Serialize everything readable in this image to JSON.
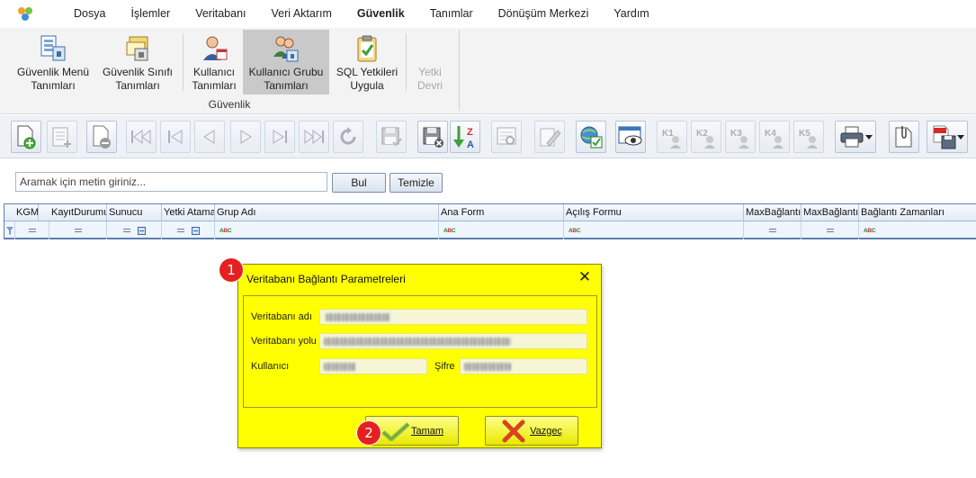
{
  "menu": {
    "items": [
      "Dosya",
      "İşlemler",
      "Veritabanı",
      "Veri Aktarım",
      "Güvenlik",
      "Tanımlar",
      "Dönüşüm Merkezi",
      "Yardım"
    ],
    "active": "Güvenlik"
  },
  "ribbon": {
    "group_label": "Güvenlik",
    "buttons": [
      {
        "line1": "Güvenlik Menü",
        "line2": "Tanımları",
        "icon": "menu-security-icon"
      },
      {
        "line1": "Güvenlik Sınıfı",
        "line2": "Tanımları",
        "icon": "security-class-icon"
      },
      {
        "line1": "Kullanıcı",
        "line2": "Tanımları",
        "icon": "user-icon"
      },
      {
        "line1": "Kullanıcı Grubu",
        "line2": "Tanımları",
        "icon": "user-group-icon",
        "selected": true
      },
      {
        "line1": "SQL Yetkileri",
        "line2": "Uygula",
        "icon": "clipboard-check-icon"
      },
      {
        "line1": "Yetki",
        "line2": "Devri",
        "icon": "none",
        "disabled": true
      }
    ]
  },
  "toolbar": {
    "k_labels": [
      "K1",
      "K2",
      "K3",
      "K4",
      "K5"
    ],
    "sort_label_top": "Z",
    "sort_label_bottom": "A"
  },
  "search": {
    "placeholder": "Aramak için metin giriniz...",
    "find_label": "Bul",
    "clear_label": "Temizle"
  },
  "grid": {
    "columns": [
      "KGM",
      "KayıtDurumu",
      "Sunucu",
      "Yetki Atama",
      "Grup Adı",
      "Ana Form",
      "Açılış Formu",
      "MaxBağlantı",
      "MaxBağlantı",
      "Bağlantı Zamanları"
    ],
    "abc_label_a": "A",
    "abc_label_b": "B",
    "abc_label_c": "C"
  },
  "dialog": {
    "title": "Veritabanı Bağlantı Parametreleri",
    "close_glyph": "✕",
    "db_name_label": "Veritabanı adı",
    "db_path_label": "Veritabanı yolu",
    "user_label": "Kullanıcı",
    "password_label": "Şifre",
    "ok_label": "Tamam",
    "cancel_label": "Vazgeç"
  },
  "badges": [
    "1",
    "2"
  ],
  "colors": {
    "dialog_background": "#ffff00",
    "badge": "#e62020",
    "selected_ribbon": "#c9c9c9",
    "grid_accent": "#5b7fb0"
  }
}
